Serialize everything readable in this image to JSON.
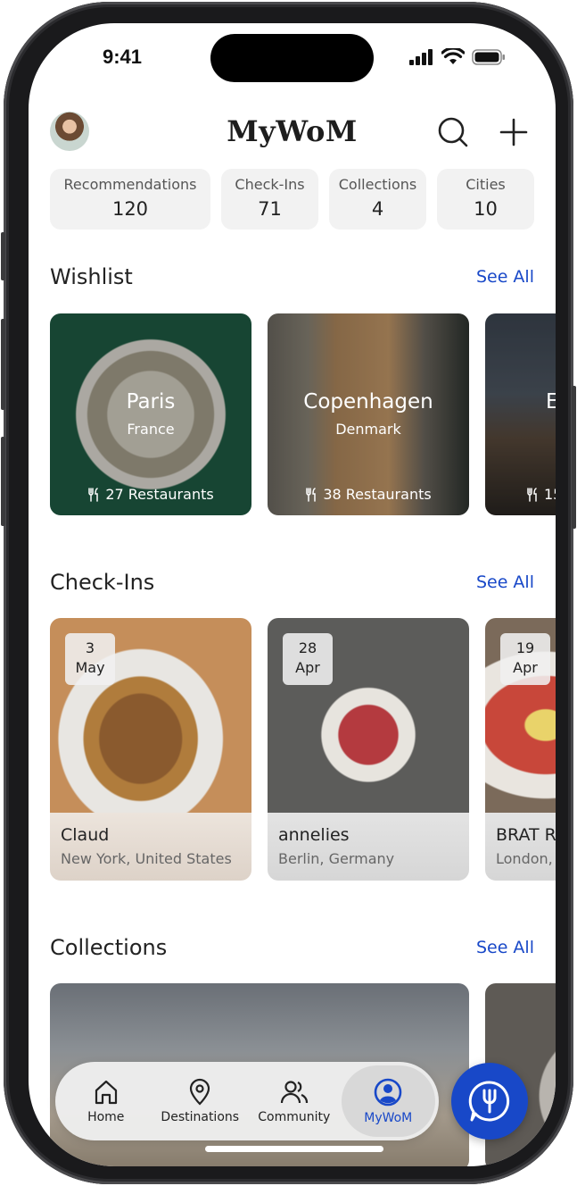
{
  "status": {
    "time": "9:41"
  },
  "header": {
    "title": "MyWoM"
  },
  "stats": [
    {
      "label": "Recommendations",
      "value": "120"
    },
    {
      "label": "Check-Ins",
      "value": "71"
    },
    {
      "label": "Collections",
      "value": "4"
    },
    {
      "label": "Cities",
      "value": "10"
    }
  ],
  "wishlist": {
    "title": "Wishlist",
    "see_all": "See All",
    "items": [
      {
        "city": "Paris",
        "country": "France",
        "count": "27 Restaurants"
      },
      {
        "city": "Copenhagen",
        "country": "Denmark",
        "count": "38 Restaurants"
      },
      {
        "city": "E",
        "country": "",
        "count": "15"
      }
    ]
  },
  "checkins": {
    "title": "Check-Ins",
    "see_all": "See All",
    "items": [
      {
        "day": "3",
        "month": "May",
        "name": "Claud",
        "location": "New York, United States"
      },
      {
        "day": "28",
        "month": "Apr",
        "name": "annelies",
        "location": "Berlin, Germany"
      },
      {
        "day": "19",
        "month": "Apr",
        "name": "BRAT R",
        "location": "London,"
      }
    ]
  },
  "collections": {
    "title": "Collections",
    "see_all": "See All"
  },
  "tabbar": {
    "items": [
      {
        "label": "Home"
      },
      {
        "label": "Destinations"
      },
      {
        "label": "Community"
      },
      {
        "label": "MyWoM"
      }
    ]
  },
  "colors": {
    "accent": "#1848c8",
    "stat_bg": "#f2f2f2",
    "text": "#222222"
  }
}
